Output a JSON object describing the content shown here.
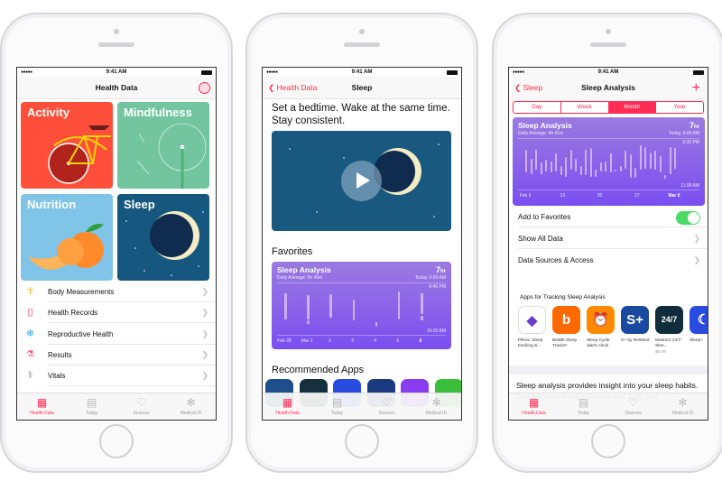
{
  "status": {
    "time": "9:41 AM"
  },
  "tabbar": {
    "items": [
      {
        "label": "Health Data",
        "icon": "grid-icon",
        "active": true
      },
      {
        "label": "Today",
        "icon": "calendar-icon"
      },
      {
        "label": "Sources",
        "icon": "download-heart-icon"
      },
      {
        "label": "Medical ID",
        "icon": "asterisk-icon"
      }
    ]
  },
  "colors": {
    "accent": "#ff2d55",
    "activity": "#ff4f3a",
    "mindfulness": "#73c5a0",
    "nutrition": "#80c4e8",
    "sleep": "#15577f",
    "card": "#8a5ff0",
    "toggle": "#4cd964"
  },
  "screen1": {
    "title": "Health Data",
    "tiles": [
      "Activity",
      "Mindfulness",
      "Nutrition",
      "Sleep"
    ],
    "rows": [
      {
        "label": "Body Measurements",
        "icon": "person-icon",
        "color": "#f7a400"
      },
      {
        "label": "Health Records",
        "icon": "clipboard-icon",
        "color": "#ff2d55"
      },
      {
        "label": "Reproductive Health",
        "icon": "snowflake-icon",
        "color": "#2ea8f0"
      },
      {
        "label": "Results",
        "icon": "flask-icon",
        "color": "#ff5a8a"
      },
      {
        "label": "Vitals",
        "icon": "stethoscope-icon",
        "color": "#888"
      }
    ]
  },
  "screen2": {
    "back": "Health Data",
    "title": "Sleep",
    "headline": "Set a bedtime. Wake at the same time. Stay consistent.",
    "favorites": "Favorites",
    "recommended": "Recommended Apps",
    "card": {
      "title": "Sleep Analysis",
      "subtitle": "Daily Average: 5h 49m",
      "value": "7",
      "unit": "hr",
      "date": "Today, 6:00 AM",
      "top_label": "6:45 PM",
      "bottom_label": "10:30 AM",
      "x_labels": [
        "Feb 28",
        "Mar 1",
        "2",
        "3",
        "4",
        "5",
        "6"
      ],
      "range_hours": [
        18.75,
        34.5
      ],
      "bars": [
        [
          [
            20.3,
            29.8
          ]
        ],
        [
          [
            21.2,
            29.8
          ],
          [
            30.2,
            31.5
          ]
        ],
        [
          [
            20.8,
            29.2
          ]
        ],
        [
          [
            22.6,
            30.3
          ]
        ],
        [
          [
            31.0,
            32.5
          ]
        ],
        [
          [
            19.6,
            30
          ]
        ],
        [
          [
            20.3,
            27.9
          ],
          [
            28.5,
            30.2
          ]
        ]
      ]
    },
    "app_colors": [
      "#1e4e8c",
      "#14303c",
      "#2a4be0",
      "#1b3a80",
      "#8a3cf0",
      "#3bbf3b"
    ]
  },
  "screen3": {
    "back": "Sleep",
    "title": "Sleep Analysis",
    "add": "+",
    "segments": [
      "Day",
      "Week",
      "Month",
      "Year"
    ],
    "selected_segment": "Month",
    "card": {
      "title": "Sleep Analysis",
      "subtitle": "Daily Average: 4h 41m",
      "value": "7",
      "unit": "hr",
      "date": "Today, 6:00 AM",
      "top_label": "6:30 PM",
      "bottom_label": "11:00 AM",
      "x_labels": [
        "Feb 6",
        "13",
        "20",
        "27",
        "Mar 6"
      ],
      "range_hours": [
        18.5,
        35
      ],
      "bars": [
        [
          20.5,
          29.5
        ],
        [
          24,
          30
        ],
        [
          20.5,
          28.5
        ],
        [
          25.5,
          30
        ],
        [
          24.5,
          29
        ],
        [
          25,
          29.5
        ],
        [
          22,
          29
        ],
        [
          27,
          30.5
        ],
        [
          23.5,
          31
        ],
        [
          20.5,
          28.5
        ],
        [
          24,
          29
        ],
        [
          27,
          30.5
        ],
        [
          20.5,
          30.5
        ],
        [
          20,
          31
        ],
        [
          28.5,
          31
        ],
        [
          25.5,
          29
        ],
        [
          25,
          29
        ],
        [
          22,
          29.5
        ],
        [
          28.5,
          29
        ],
        [
          27,
          29
        ],
        [
          21,
          28
        ],
        [
          22.5,
          31.5
        ],
        [
          27.5,
          31.5
        ],
        [
          19,
          28.5
        ],
        [
          19.5,
          28
        ],
        [
          21.5,
          28
        ],
        [
          21,
          28.5
        ],
        [
          23,
          29.5
        ],
        [
          30.5,
          32
        ],
        [
          19.5,
          30
        ],
        [
          20,
          28
        ]
      ]
    },
    "toggle_row": {
      "label": "Add to Favorites",
      "on": true
    },
    "rows": [
      "Show All Data",
      "Data Sources & Access"
    ],
    "apps_header": "Apps for Tracking Sleep Analysis",
    "apps": [
      {
        "name": "Pillow: Sleep tracking &...",
        "color": "#6a3cd0",
        "bg": "#fff",
        "glyph": "◆"
      },
      {
        "name": "Beddit Sleep Tracker",
        "color": "#ff6a00",
        "glyph": "b"
      },
      {
        "name": "Sleep Cycle alarm clock",
        "color": "#ff8a00",
        "glyph": "⏰"
      },
      {
        "name": "S+ by ResMed",
        "color": "#1a4aa0",
        "glyph": "S+"
      },
      {
        "name": "MotionX 24/7: Slee...",
        "price": "$0.99",
        "color": "#0f2d3a",
        "glyph": "24/7"
      },
      {
        "name": "Sleep+",
        "color": "#2a4be0",
        "glyph": "☾"
      }
    ],
    "description": "Sleep analysis provides insight into your sleep habits. Sleep trackers and monitors can help you"
  }
}
